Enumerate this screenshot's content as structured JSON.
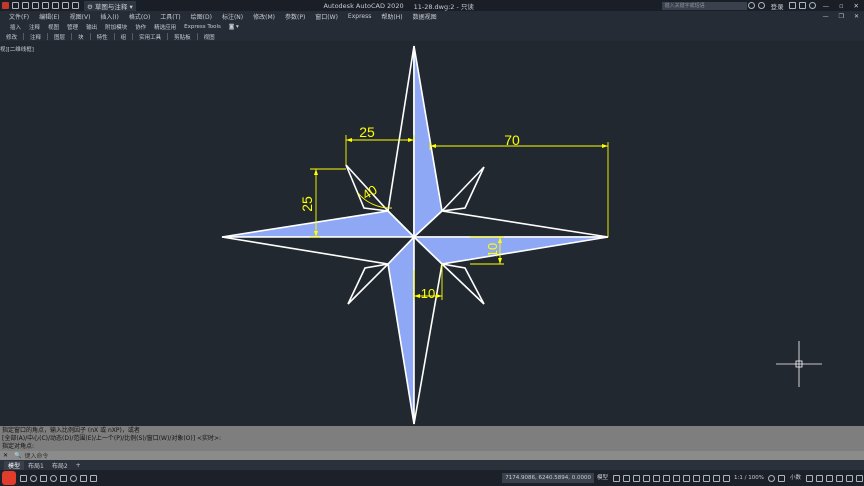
{
  "title": {
    "quickaccess_label": "草图与注释",
    "app": "Autodesk AutoCAD 2020",
    "file": "11-28.dwg:2 - 只读",
    "search_placeholder": "键入关键字或短语",
    "login": "登录"
  },
  "menu": [
    "文件(F)",
    "编辑(E)",
    "视图(V)",
    "插入(I)",
    "格式(O)",
    "工具(T)",
    "绘图(D)",
    "标注(N)",
    "修改(M)",
    "参数(P)",
    "窗口(W)",
    "Express",
    "帮助(H)",
    "数据视图"
  ],
  "ribbon_tabs": [
    "插入",
    "注释",
    "视图",
    "管理",
    "输出",
    "附加模块",
    "协作",
    "精选应用",
    "Express Tools"
  ],
  "ribbon_panels": [
    "修改",
    "注释",
    "图层",
    "块",
    "特性",
    "组",
    "实用工具",
    "剪贴板",
    "视图"
  ],
  "viewport_label": "视][二维线框]",
  "dimensions": {
    "d25_top": "25",
    "d70": "70",
    "d25_left": "25",
    "d40": "40",
    "d10": "10",
    "d10_side": "10"
  },
  "colors": {
    "fill": "#8fa8f5",
    "outline": "#ffffff",
    "dimension": "#ffff00",
    "background": "#212830"
  },
  "command_history": [
    "指定窗口的角点，输入比例因子 (nX 或 nXP)，或者",
    "[全部(A)/中心(C)/动态(D)/范围(E)/上一个(P)/比例(S)/窗口(W)/对象(O)] <实时>:",
    "指定对角点:"
  ],
  "command_placeholder": "键入命令",
  "layout_tabs": [
    "模型",
    "布局1",
    "布局2"
  ],
  "status": {
    "coords": "7174.9086, 6240.5894, 0.0000",
    "mode": "模型",
    "scale": "1:1 / 100%",
    "units": "小数"
  }
}
